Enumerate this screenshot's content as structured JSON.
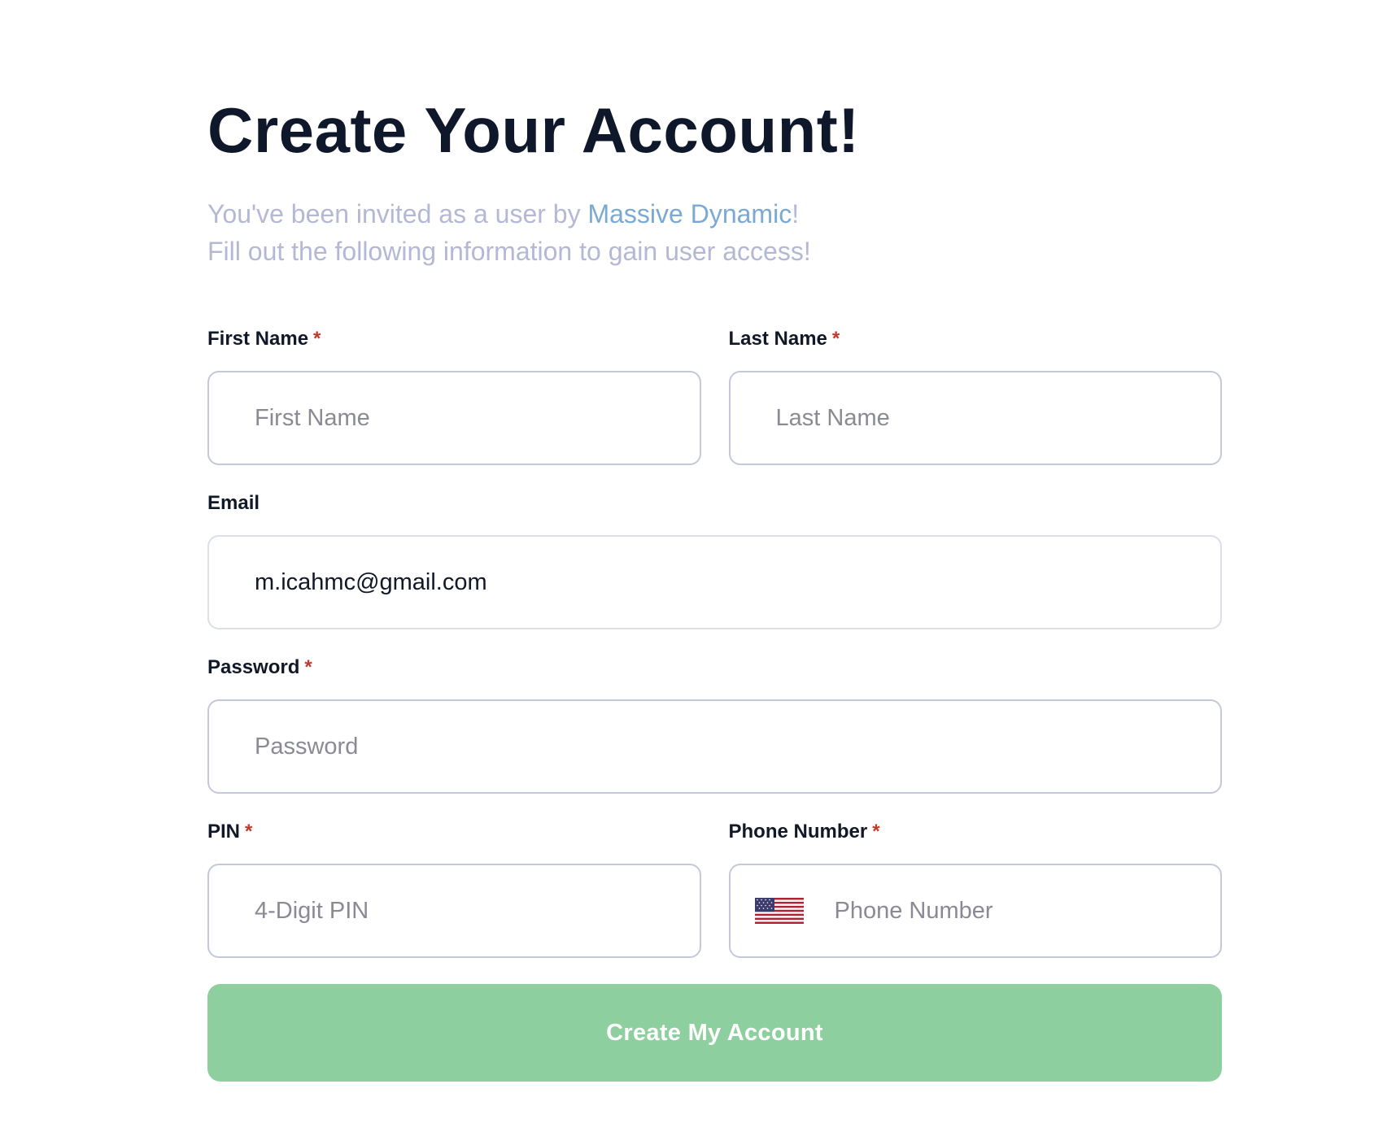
{
  "header": {
    "title": "Create Your Account!",
    "invite_prefix": "You've been invited as a user by ",
    "invite_org": "Massive Dynamic",
    "invite_suffix": "!",
    "instructions": "Fill out the following information to gain user access!"
  },
  "form": {
    "first_name": {
      "label": "First Name",
      "required_mark": "*",
      "placeholder": "First Name",
      "value": ""
    },
    "last_name": {
      "label": "Last Name",
      "required_mark": "*",
      "placeholder": "Last Name",
      "value": ""
    },
    "email": {
      "label": "Email",
      "placeholder": "",
      "value": "m.icahmc@gmail.com"
    },
    "password": {
      "label": "Password",
      "required_mark": "*",
      "placeholder": "Password",
      "value": ""
    },
    "pin": {
      "label": "PIN",
      "required_mark": "*",
      "placeholder": "4-Digit PIN",
      "value": ""
    },
    "phone": {
      "label": "Phone Number",
      "required_mark": "*",
      "placeholder": "Phone Number",
      "value": "",
      "country_flag": "us-flag-icon"
    },
    "submit_label": "Create My Account"
  },
  "colors": {
    "title": "#0f172a",
    "subtitle": "#b5b8d4",
    "org_link": "#7aa9d4",
    "required": "#c0392b",
    "input_border": "#c5c8d8",
    "submit_bg": "#8dcf9f",
    "submit_text": "#ffffff"
  }
}
